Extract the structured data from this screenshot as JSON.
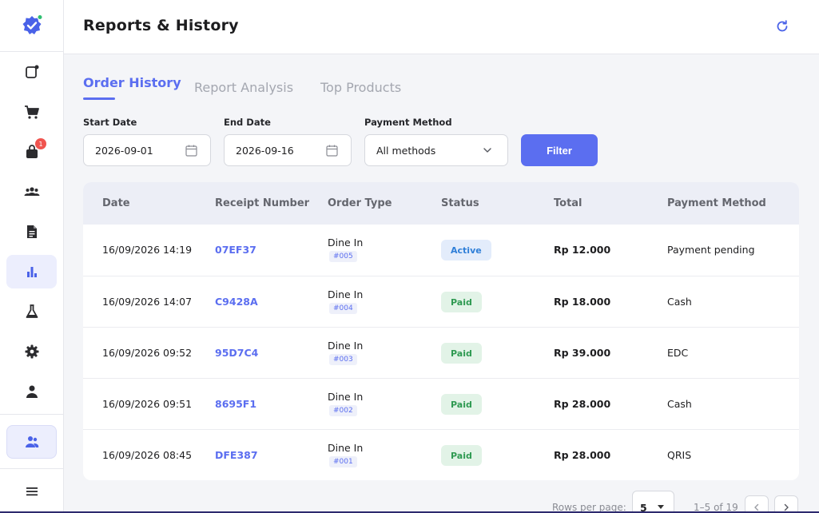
{
  "app": {
    "title": "Reports & History"
  },
  "sidebar": {
    "items": [
      {
        "icon": "new-order-icon"
      },
      {
        "icon": "cart-icon"
      },
      {
        "icon": "bag-icon",
        "badge": "1"
      },
      {
        "icon": "customers-icon"
      },
      {
        "icon": "document-icon"
      },
      {
        "icon": "bar-chart-icon",
        "active": true
      },
      {
        "icon": "flask-icon"
      },
      {
        "icon": "gear-icon"
      },
      {
        "icon": "person-icon"
      },
      {
        "icon": "staff-icon"
      },
      {
        "icon": "menu-icon"
      }
    ]
  },
  "tabs": [
    {
      "label": "Order History",
      "active": true
    },
    {
      "label": "Report Analysis",
      "active": false
    },
    {
      "label": "Top Products",
      "active": false
    }
  ],
  "filters": {
    "start_label": "Start Date",
    "start_value": "2026-09-01",
    "end_label": "End Date",
    "end_value": "2026-09-16",
    "method_label": "Payment Method",
    "method_value": "All methods",
    "filter_button": "Filter"
  },
  "table": {
    "headers": [
      "Date",
      "Receipt Number",
      "Order Type",
      "Status",
      "Total",
      "Payment Method"
    ],
    "rows": [
      {
        "date": "16/09/2026 14:19",
        "receipt": "07EF37",
        "type": "Dine In",
        "tag": "#005",
        "status": "Active",
        "status_kind": "active",
        "total": "Rp 12.000",
        "method": "Payment pending"
      },
      {
        "date": "16/09/2026 14:07",
        "receipt": "C9428A",
        "type": "Dine In",
        "tag": "#004",
        "status": "Paid",
        "status_kind": "paid",
        "total": "Rp 18.000",
        "method": "Cash"
      },
      {
        "date": "16/09/2026 09:52",
        "receipt": "95D7C4",
        "type": "Dine In",
        "tag": "#003",
        "status": "Paid",
        "status_kind": "paid",
        "total": "Rp 39.000",
        "method": "EDC"
      },
      {
        "date": "16/09/2026 09:51",
        "receipt": "8695F1",
        "type": "Dine In",
        "tag": "#002",
        "status": "Paid",
        "status_kind": "paid",
        "total": "Rp 28.000",
        "method": "Cash"
      },
      {
        "date": "16/09/2026 08:45",
        "receipt": "DFE387",
        "type": "Dine In",
        "tag": "#001",
        "status": "Paid",
        "status_kind": "paid",
        "total": "Rp 28.000",
        "method": "QRIS"
      }
    ]
  },
  "pagination": {
    "rows_per_page_label": "Rows per page:",
    "rows_per_page": "5",
    "range": "1–5 of 19"
  },
  "colors": {
    "accent": "#5b6ef0",
    "active_status": "#2f7fd8",
    "paid_status": "#2f9a52"
  }
}
